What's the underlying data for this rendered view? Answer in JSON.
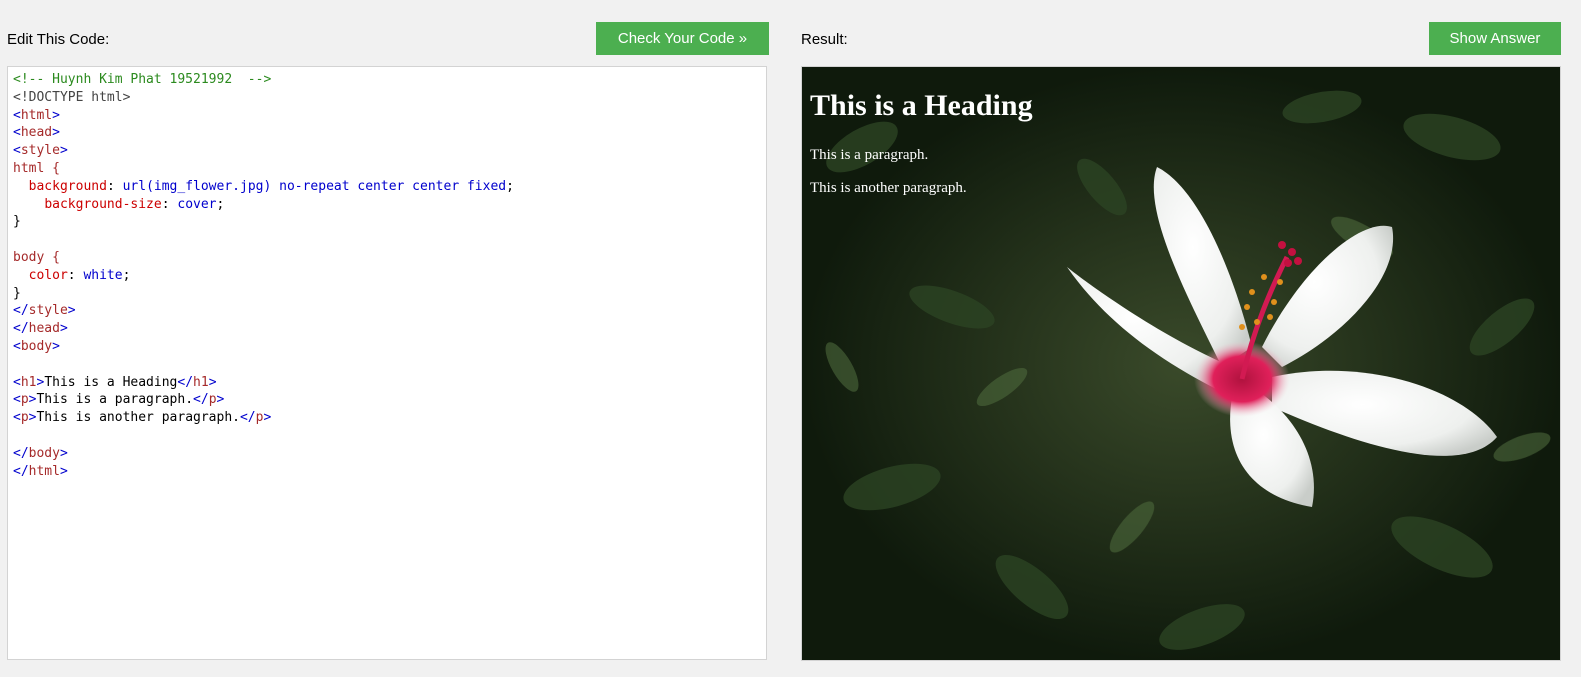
{
  "editor_panel": {
    "label": "Edit This Code:",
    "check_button": "Check Your Code »",
    "code_lines": [
      [
        {
          "t": "comment",
          "v": "<!-- Huynh Kim Phat 19521992  -->"
        }
      ],
      [
        {
          "t": "doctype",
          "v": "<!DOCTYPE html>"
        }
      ],
      [
        {
          "t": "tag",
          "v": "<"
        },
        {
          "t": "tagname",
          "v": "html"
        },
        {
          "t": "tag",
          "v": ">"
        }
      ],
      [
        {
          "t": "tag",
          "v": "<"
        },
        {
          "t": "tagname",
          "v": "head"
        },
        {
          "t": "tag",
          "v": ">"
        }
      ],
      [
        {
          "t": "tag",
          "v": "<"
        },
        {
          "t": "tagname",
          "v": "style"
        },
        {
          "t": "tag",
          "v": ">"
        }
      ],
      [
        {
          "t": "sel",
          "v": "html {"
        }
      ],
      [
        {
          "t": "text",
          "v": "  "
        },
        {
          "t": "prop",
          "v": "background"
        },
        {
          "t": "text",
          "v": ": "
        },
        {
          "t": "val",
          "v": "url(img_flower.jpg) no-repeat center center fixed"
        },
        {
          "t": "text",
          "v": ";"
        }
      ],
      [
        {
          "t": "text",
          "v": "    "
        },
        {
          "t": "prop",
          "v": "background-size"
        },
        {
          "t": "text",
          "v": ": "
        },
        {
          "t": "val",
          "v": "cover"
        },
        {
          "t": "text",
          "v": ";"
        }
      ],
      [
        {
          "t": "text",
          "v": "}"
        }
      ],
      [],
      [
        {
          "t": "sel",
          "v": "body {"
        }
      ],
      [
        {
          "t": "text",
          "v": "  "
        },
        {
          "t": "prop",
          "v": "color"
        },
        {
          "t": "text",
          "v": ": "
        },
        {
          "t": "val",
          "v": "white"
        },
        {
          "t": "text",
          "v": ";"
        }
      ],
      [
        {
          "t": "text",
          "v": "}"
        }
      ],
      [
        {
          "t": "tag",
          "v": "</"
        },
        {
          "t": "tagname",
          "v": "style"
        },
        {
          "t": "tag",
          "v": ">"
        }
      ],
      [
        {
          "t": "tag",
          "v": "</"
        },
        {
          "t": "tagname",
          "v": "head"
        },
        {
          "t": "tag",
          "v": ">"
        }
      ],
      [
        {
          "t": "tag",
          "v": "<"
        },
        {
          "t": "tagname",
          "v": "body"
        },
        {
          "t": "tag",
          "v": ">"
        }
      ],
      [],
      [
        {
          "t": "tag",
          "v": "<"
        },
        {
          "t": "tagname",
          "v": "h1"
        },
        {
          "t": "tag",
          "v": ">"
        },
        {
          "t": "text",
          "v": "This is a Heading"
        },
        {
          "t": "tag",
          "v": "</"
        },
        {
          "t": "tagname",
          "v": "h1"
        },
        {
          "t": "tag",
          "v": ">"
        }
      ],
      [
        {
          "t": "tag",
          "v": "<"
        },
        {
          "t": "tagname",
          "v": "p"
        },
        {
          "t": "tag",
          "v": ">"
        },
        {
          "t": "text",
          "v": "This is a paragraph."
        },
        {
          "t": "tag",
          "v": "</"
        },
        {
          "t": "tagname",
          "v": "p"
        },
        {
          "t": "tag",
          "v": ">"
        }
      ],
      [
        {
          "t": "tag",
          "v": "<"
        },
        {
          "t": "tagname",
          "v": "p"
        },
        {
          "t": "tag",
          "v": ">"
        },
        {
          "t": "text",
          "v": "This is another paragraph."
        },
        {
          "t": "tag",
          "v": "</"
        },
        {
          "t": "tagname",
          "v": "p"
        },
        {
          "t": "tag",
          "v": ">"
        }
      ],
      [],
      [
        {
          "t": "tag",
          "v": "</"
        },
        {
          "t": "tagname",
          "v": "body"
        },
        {
          "t": "tag",
          "v": ">"
        }
      ],
      [
        {
          "t": "tag",
          "v": "</"
        },
        {
          "t": "tagname",
          "v": "html"
        },
        {
          "t": "tag",
          "v": ">"
        }
      ]
    ]
  },
  "result_panel": {
    "label": "Result:",
    "answer_button": "Show Answer",
    "heading": "This is a Heading",
    "paragraph_1": "This is a paragraph.",
    "paragraph_2": "This is another paragraph."
  },
  "colors": {
    "button_green": "#4caf50",
    "page_bg": "#f1f1f1"
  }
}
